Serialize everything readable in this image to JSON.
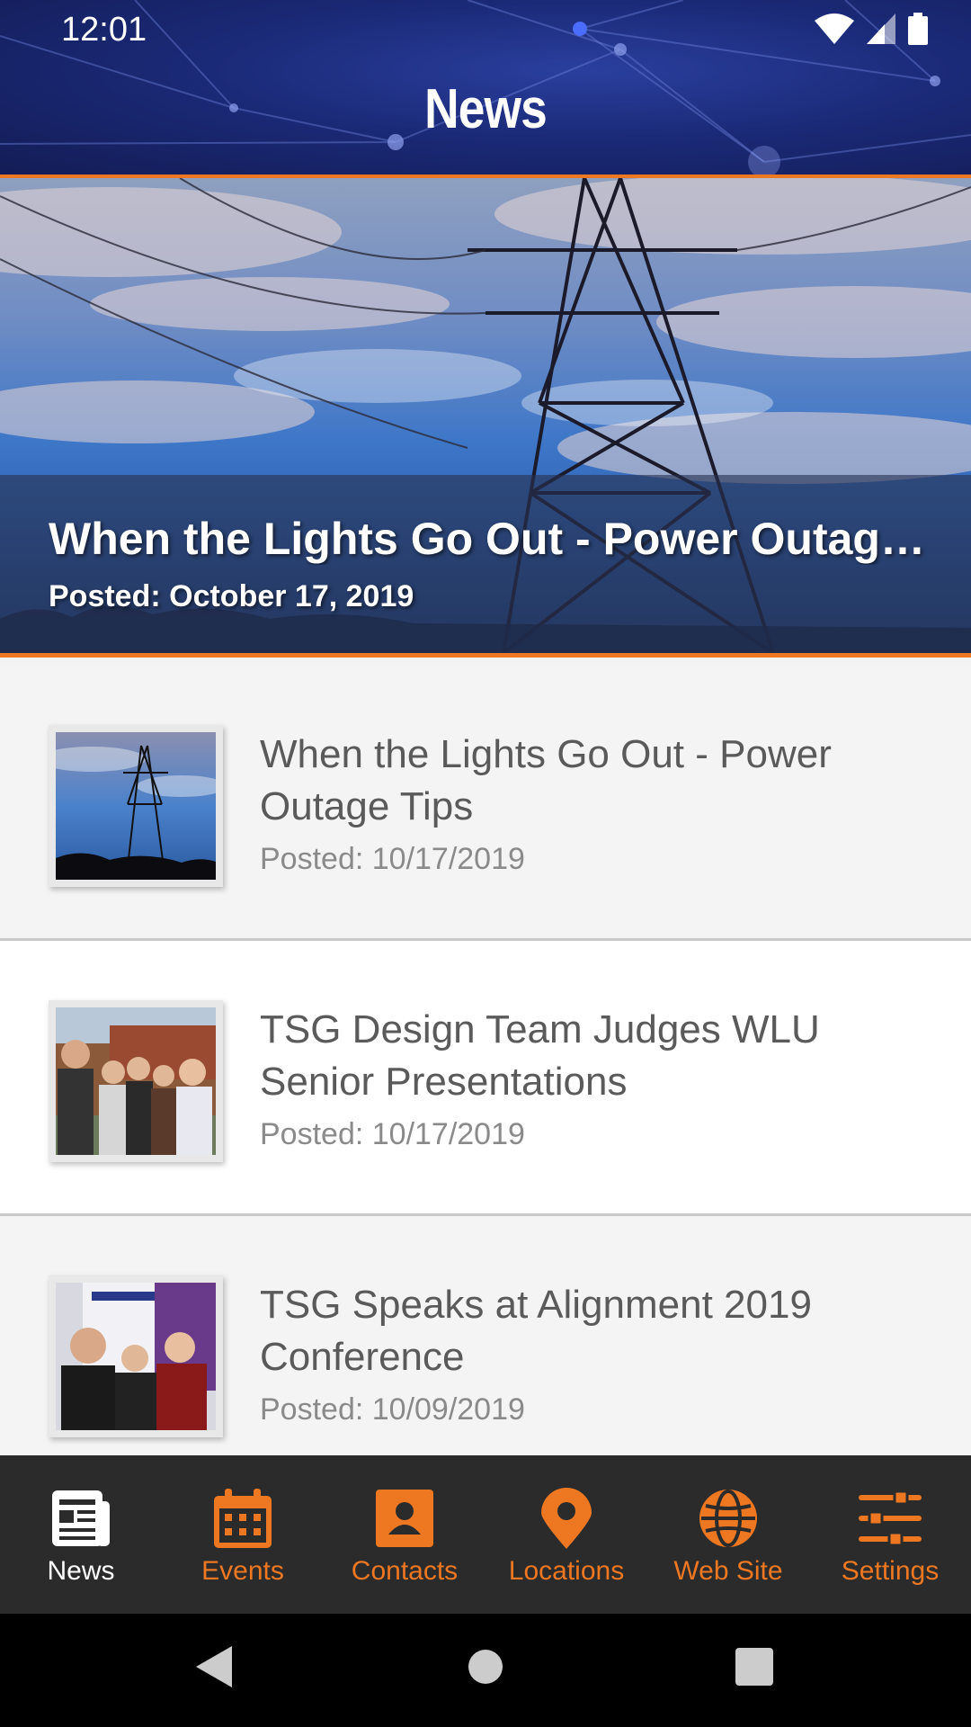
{
  "status_bar": {
    "time": "12:01",
    "icons": [
      "wifi-icon",
      "signal-icon",
      "battery-icon"
    ]
  },
  "header": {
    "title": "News"
  },
  "hero": {
    "title": "When the Lights Go Out - Power Outage Tips",
    "posted": "Posted: October 17, 2019"
  },
  "news": [
    {
      "title": "When the Lights Go Out - Power Outage Tips",
      "posted": "Posted: 10/17/2019",
      "thumb": "power-tower-photo"
    },
    {
      "title": "TSG Design Team Judges WLU Senior Presentations",
      "posted": "Posted: 10/17/2019",
      "thumb": "team-photo"
    },
    {
      "title": "TSG Speaks at Alignment 2019 Conference",
      "posted": "Posted: 10/09/2019",
      "thumb": "conference-photo"
    }
  ],
  "tabs": [
    {
      "label": "News",
      "icon": "newspaper-icon",
      "active": true
    },
    {
      "label": "Events",
      "icon": "calendar-icon",
      "active": false
    },
    {
      "label": "Contacts",
      "icon": "contact-card-icon",
      "active": false
    },
    {
      "label": "Locations",
      "icon": "map-pin-icon",
      "active": false
    },
    {
      "label": "Web Site",
      "icon": "globe-icon",
      "active": false
    },
    {
      "label": "Settings",
      "icon": "sliders-icon",
      "active": false
    }
  ],
  "colors": {
    "accent": "#ee7722",
    "header_blue": "#1b2a78",
    "tabbar": "#2b2b2b"
  }
}
